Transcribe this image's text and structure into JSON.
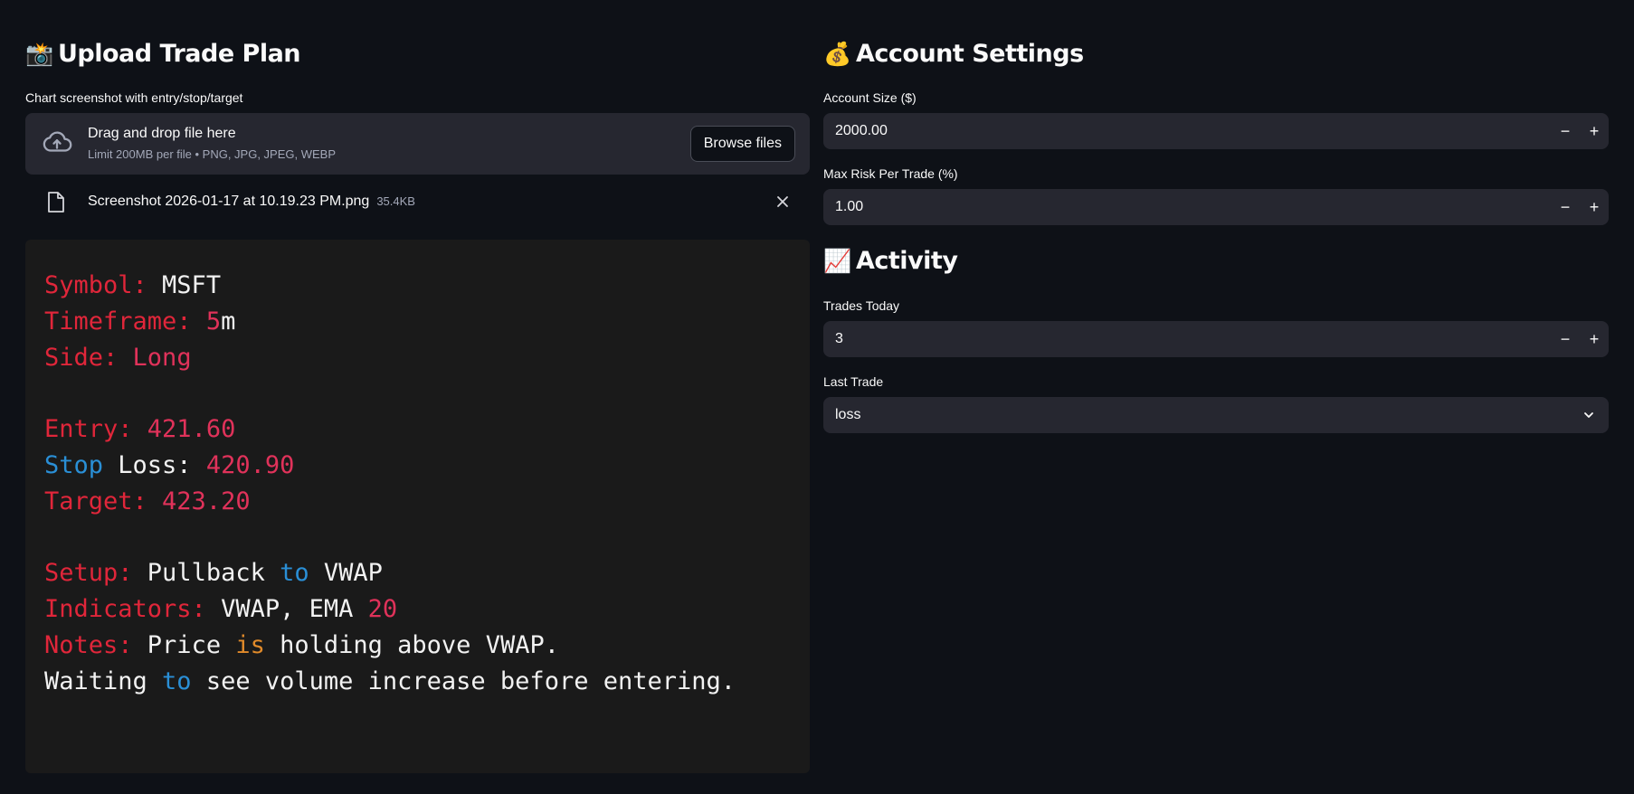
{
  "upload": {
    "emoji": "📸",
    "title": "Upload Trade Plan",
    "field_label": "Chart screenshot with entry/stop/target",
    "drop_title": "Drag and drop file here",
    "drop_limits": "Limit 200MB per file • PNG, JPG, JPEG, WEBP",
    "browse_label": "Browse files",
    "file_name": "Screenshot 2026-01-17 at 10.19.23 PM.png",
    "file_size": "35.4KB",
    "preview_lines": [
      [
        [
          "Symbol: ",
          "k"
        ],
        [
          "MSFT",
          "w"
        ]
      ],
      [
        [
          "Timeframe: ",
          "k"
        ],
        [
          "5",
          "n"
        ],
        [
          "m",
          "w"
        ]
      ],
      [
        [
          "Side: ",
          "k"
        ],
        [
          "Long",
          "n"
        ]
      ],
      [
        [
          "",
          "w"
        ]
      ],
      [
        [
          "Entry: ",
          "k"
        ],
        [
          "421.60",
          "n"
        ]
      ],
      [
        [
          "Stop",
          "b"
        ],
        [
          " Loss: ",
          "w"
        ],
        [
          "420.90",
          "n"
        ]
      ],
      [
        [
          "Target: ",
          "k"
        ],
        [
          "423.20",
          "n"
        ]
      ],
      [
        [
          "",
          "w"
        ]
      ],
      [
        [
          "Setup: ",
          "k"
        ],
        [
          "Pullback ",
          "w"
        ],
        [
          "to",
          "b"
        ],
        [
          " VWAP",
          "w"
        ]
      ],
      [
        [
          "Indicators: ",
          "k"
        ],
        [
          "VWAP, EMA ",
          "w"
        ],
        [
          "20",
          "n"
        ]
      ],
      [
        [
          "Notes: ",
          "k"
        ],
        [
          "Price ",
          "w"
        ],
        [
          "is",
          "o"
        ],
        [
          " holding above VWAP.",
          "w"
        ]
      ],
      [
        [
          "Waiting ",
          "w"
        ],
        [
          "to",
          "b"
        ],
        [
          " see volume increase before entering.",
          "w"
        ]
      ]
    ]
  },
  "account": {
    "emoji": "💰",
    "title": "Account Settings",
    "size_label": "Account Size ($)",
    "size_value": "2000.00",
    "risk_label": "Max Risk Per Trade (%)",
    "risk_value": "1.00"
  },
  "activity": {
    "emoji": "📈",
    "title": "Activity",
    "trades_label": "Trades Today",
    "trades_value": "3",
    "last_label": "Last Trade",
    "last_value": "loss"
  },
  "stepper": {
    "minus": "−",
    "plus": "+"
  },
  "colors": {
    "background": "#0e1117",
    "input_bg": "#262730",
    "text": "#fafafa",
    "muted": "#a3a8b8",
    "preview_red": "#e0263a",
    "preview_blue": "#2a8fd6",
    "preview_orange": "#e08a2a"
  },
  "icons": [
    "camera-flash-icon",
    "cloud-upload-icon",
    "file-icon",
    "close-icon",
    "money-bag-icon",
    "chart-increasing-icon",
    "minus-icon",
    "plus-icon",
    "chevron-down-icon"
  ]
}
